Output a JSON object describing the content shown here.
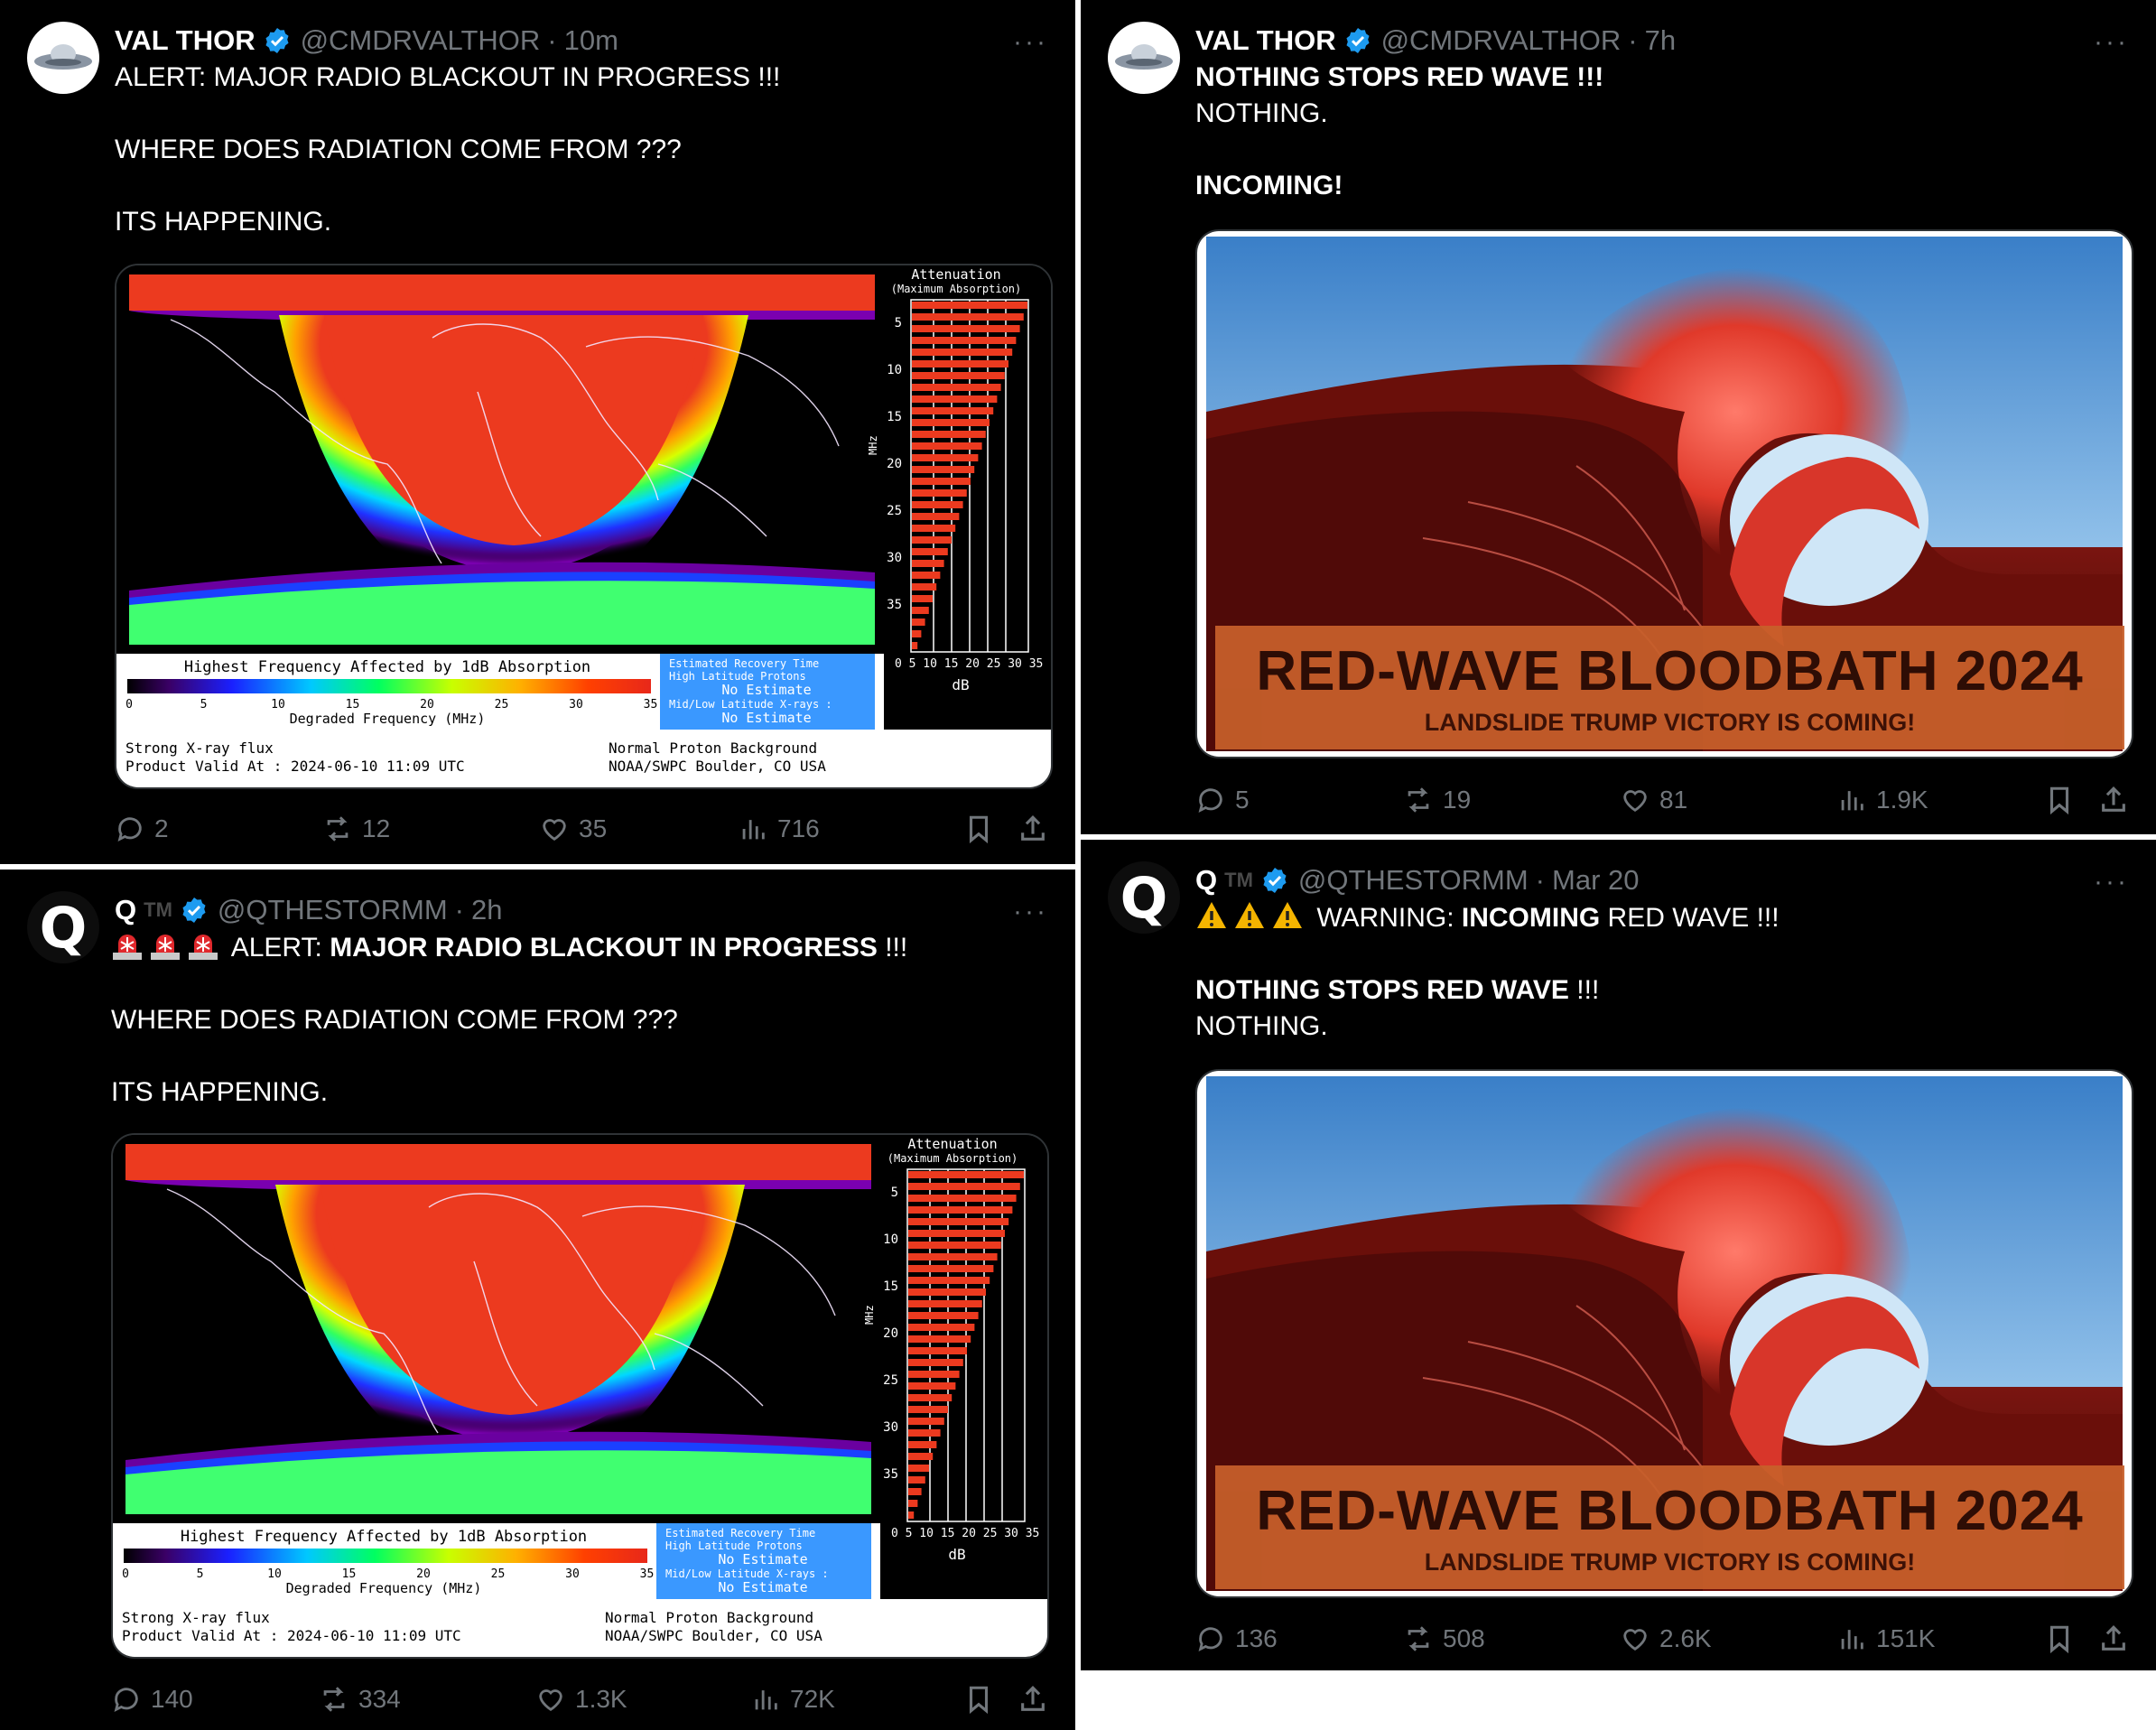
{
  "posts": [
    {
      "author": "VAL THOR",
      "handle": "@CMDRVALTHOR",
      "time": "10m",
      "lines": [
        "ALERT: MAJOR RADIO BLACKOUT IN PROGRESS !!!",
        "WHERE DOES RADIATION COME FROM ???",
        "ITS HAPPENING."
      ],
      "stats": {
        "replies": "2",
        "reposts": "12",
        "likes": "35",
        "views": "716"
      }
    },
    {
      "author": "VAL THOR",
      "handle": "@CMDRVALTHOR",
      "time": "7h",
      "lines": [
        "NOTHING STOPS RED WAVE !!!",
        "NOTHING.",
        "INCOMING!"
      ],
      "stats": {
        "replies": "5",
        "reposts": "19",
        "likes": "81",
        "views": "1.9K"
      }
    },
    {
      "author": "Q",
      "tm": "TM",
      "handle": "@QTHESTORMM",
      "time": "2h",
      "lines": [
        "ALERT: ",
        "MAJOR RADIO BLACKOUT IN PROGRESS",
        " !!!",
        "WHERE DOES RADIATION COME FROM ???",
        "ITS HAPPENING."
      ],
      "stats": {
        "replies": "140",
        "reposts": "334",
        "likes": "1.3K",
        "views": "72K"
      }
    },
    {
      "author": "Q",
      "tm": "TM",
      "handle": "@QTHESTORMM",
      "time": "Mar 20",
      "lines": [
        "WARNING: ",
        "INCOMING",
        " RED WAVE !!!",
        "NOTHING STOPS RED WAVE",
        " !!!",
        "NOTHING."
      ],
      "stats": {
        "replies": "136",
        "reposts": "508",
        "likes": "2.6K",
        "views": "151K"
      }
    }
  ],
  "map": {
    "attenuation_title": "Attenuation",
    "attenuation_sub": "(Maximum Absorption)",
    "mhz": "MHz",
    "y_ticks": [
      "5",
      "10",
      "15",
      "20",
      "25",
      "30",
      "35"
    ],
    "x_ticks": "0  5 10 15 20 25 30 35",
    "db": "dB",
    "bar_title": "Highest Frequency Affected by 1dB Absorption",
    "bar_ticks": [
      "0",
      "5",
      "10",
      "15",
      "20",
      "25",
      "30",
      "35"
    ],
    "bar_label": "Degraded Frequency (MHz)",
    "recovery_title": "Estimated Recovery Time",
    "recovery_1": "High Latitude Protons",
    "recovery_2": "No Estimate",
    "recovery_3": "Mid/Low Latitude X-rays :",
    "recovery_4": "No Estimate",
    "foot_left_1": "Strong X-ray flux",
    "foot_left_2": "Product Valid At : 2024-06-10 11:09 UTC",
    "foot_right_1": "Normal Proton Background",
    "foot_right_2": "NOAA/SWPC Boulder, CO USA"
  },
  "wave": {
    "title": "RED-WAVE BLOODBATH 2024",
    "subtitle": "LANDSLIDE TRUMP VICTORY IS COMING!"
  },
  "colors": {
    "background": "#000000",
    "muted": "#71767b",
    "verified": "#1d9bf0",
    "text": "#e7e9ea"
  },
  "icons": [
    "reply-icon",
    "repost-icon",
    "like-icon",
    "views-icon",
    "bookmark-icon",
    "share-icon",
    "verified-icon",
    "more-icon",
    "siren-icon",
    "warning-icon"
  ]
}
